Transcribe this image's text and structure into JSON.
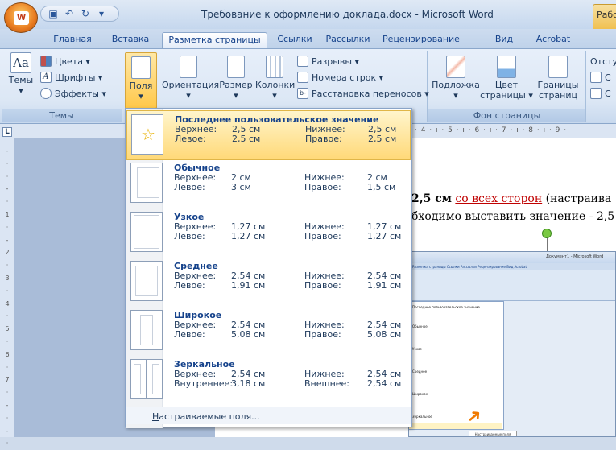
{
  "window": {
    "title": "Требование к оформлению доклада.docx - Microsoft Word",
    "context_tab": "Работа"
  },
  "qat": {
    "save_icon": "save-icon",
    "undo_icon": "undo-icon",
    "redo_icon": "redo-icon",
    "dropdown": "▾"
  },
  "tabs": [
    {
      "label": "Главная"
    },
    {
      "label": "Вставка"
    },
    {
      "label": "Разметка страницы",
      "active": true
    },
    {
      "label": "Ссылки"
    },
    {
      "label": "Рассылки"
    },
    {
      "label": "Рецензирование"
    },
    {
      "label": "Вид"
    },
    {
      "label": "Acrobat"
    }
  ],
  "ribbon": {
    "themes": {
      "label": "Темы",
      "big_button": "Темы",
      "colors": "Цвета ▾",
      "fonts": "Шрифты ▾",
      "effects": "Эффекты ▾"
    },
    "page_setup": {
      "margins": "Поля",
      "orientation": "Ориентация",
      "size": "Размер",
      "columns": "Колонки",
      "breaks": "Разрывы ▾",
      "line_numbers": "Номера строк ▾",
      "hyphenation": "Расстановка переносов ▾"
    },
    "page_background": {
      "label": "Фон страницы",
      "watermark": "Подложка",
      "page_color_1": "Цвет",
      "page_color_2": "страницы ▾",
      "borders_1": "Границы",
      "borders_2": "страниц"
    },
    "paragraph": {
      "indent": "Отсту"
    }
  },
  "ruler": {
    "numbers": "· 4 · ı · 5 · ı · 6 · ı · 7 · ı · 8 · ı · 9 ·"
  },
  "document": {
    "line1_bold": "2,5 см",
    "line1_link": "со всех сторон",
    "line1_rest": " (настраива",
    "line2": "бходимо выставить значение - 2,5"
  },
  "margins_menu": {
    "items": [
      {
        "name": "Последнее пользовательское значение",
        "top_label": "Верхнее:",
        "top": "2,5 см",
        "bottom_label": "Нижнее:",
        "bottom": "2,5 см",
        "left_label": "Левое:",
        "left": "2,5 см",
        "right_label": "Правое:",
        "right": "2,5 см"
      },
      {
        "name": "Обычное",
        "top_label": "Верхнее:",
        "top": "2 см",
        "bottom_label": "Нижнее:",
        "bottom": "2 см",
        "left_label": "Левое:",
        "left": "3 см",
        "right_label": "Правое:",
        "right": "1,5 см"
      },
      {
        "name": "Узкое",
        "top_label": "Верхнее:",
        "top": "1,27 см",
        "bottom_label": "Нижнее:",
        "bottom": "1,27 см",
        "left_label": "Левое:",
        "left": "1,27 см",
        "right_label": "Правое:",
        "right": "1,27 см"
      },
      {
        "name": "Среднее",
        "top_label": "Верхнее:",
        "top": "2,54 см",
        "bottom_label": "Нижнее:",
        "bottom": "2,54 см",
        "left_label": "Левое:",
        "left": "1,91 см",
        "right_label": "Правое:",
        "right": "1,91 см"
      },
      {
        "name": "Широкое",
        "top_label": "Верхнее:",
        "top": "2,54 см",
        "bottom_label": "Нижнее:",
        "bottom": "2,54 см",
        "left_label": "Левое:",
        "left": "5,08 см",
        "right_label": "Правое:",
        "right": "5,08 см"
      },
      {
        "name": "Зеркальное",
        "top_label": "Верхнее:",
        "top": "2,54 см",
        "bottom_label": "Нижнее:",
        "bottom": "2,54 см",
        "left_label": "Внутреннее:",
        "left": "3,18 см",
        "right_label": "Внешнее:",
        "right": "2,54 см"
      }
    ],
    "custom_mnemonic": "Н",
    "custom_rest": "астраиваемые поля..."
  },
  "embedded_screenshot": {
    "title": "Документ1 - Microsoft Word",
    "tabs": "Разметка страницы   Ссылки   Рассылки   Рецензирование   Вид   Acrobat",
    "caption": "Настраиваемые поля"
  }
}
